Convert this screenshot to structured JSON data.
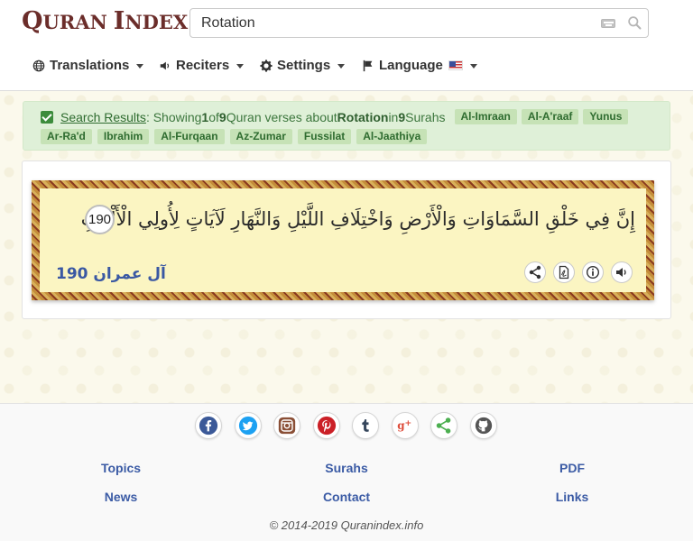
{
  "header": {
    "logo": {
      "word1_first": "Q",
      "word1_rest": "URAN",
      "word2_first": "I",
      "word2_rest": "NDEX"
    },
    "search": {
      "value": "Rotation",
      "placeholder": ""
    },
    "menu": [
      {
        "label": "Translations",
        "icon": "globe-icon"
      },
      {
        "label": "Reciters",
        "icon": "volume-icon"
      },
      {
        "label": "Settings",
        "icon": "gear-icon"
      },
      {
        "label": "Language",
        "icon": "flag-icon"
      }
    ]
  },
  "results": {
    "link_text": "Search Results",
    "prefix": ": Showing ",
    "count_shown": "1",
    "of_text": " of ",
    "count_total": "9",
    "middle": " Quran verses about ",
    "query": "Rotation",
    "in_text": " in ",
    "surah_count": "9",
    "surahs_word": " Surahs",
    "tags": [
      "Al-Imraan",
      "Al-A'raaf",
      "Yunus",
      "Ar-Ra'd",
      "Ibrahim",
      "Al-Furqaan",
      "Az-Zumar",
      "Fussilat",
      "Al-Jaathiya"
    ]
  },
  "verse": {
    "arabic": "إِنَّ فِي خَلْقِ السَّمَاوَاتِ وَالْأَرْضِ وَاخْتِلَافِ اللَّيْلِ وَالنَّهَارِ لَآيَاتٍ لِأُولِي الْأَلْبَابِ",
    "ayah_number": "190",
    "surah_name": "آل عمران",
    "reference_number": "190",
    "actions": [
      "share-icon",
      "pdf-icon",
      "info-icon",
      "audio-icon"
    ]
  },
  "footer": {
    "social": [
      "facebook-icon",
      "twitter-icon",
      "instagram-icon",
      "pinterest-icon",
      "tumblr-icon",
      "google-plus-icon",
      "share-icon",
      "github-icon"
    ],
    "links": {
      "topics": "Topics",
      "surahs": "Surahs",
      "pdf": "PDF",
      "news": "News",
      "contact": "Contact",
      "links": "Links"
    },
    "copyright": "© 2014-2019 Quranindex.info"
  },
  "colors": {
    "brand": "#6b2d2a",
    "alert_bg": "#dff0d8",
    "tag_bg": "#c6e2b6",
    "link": "#3b5ba5",
    "verse_bg": "#fbf5c2"
  }
}
